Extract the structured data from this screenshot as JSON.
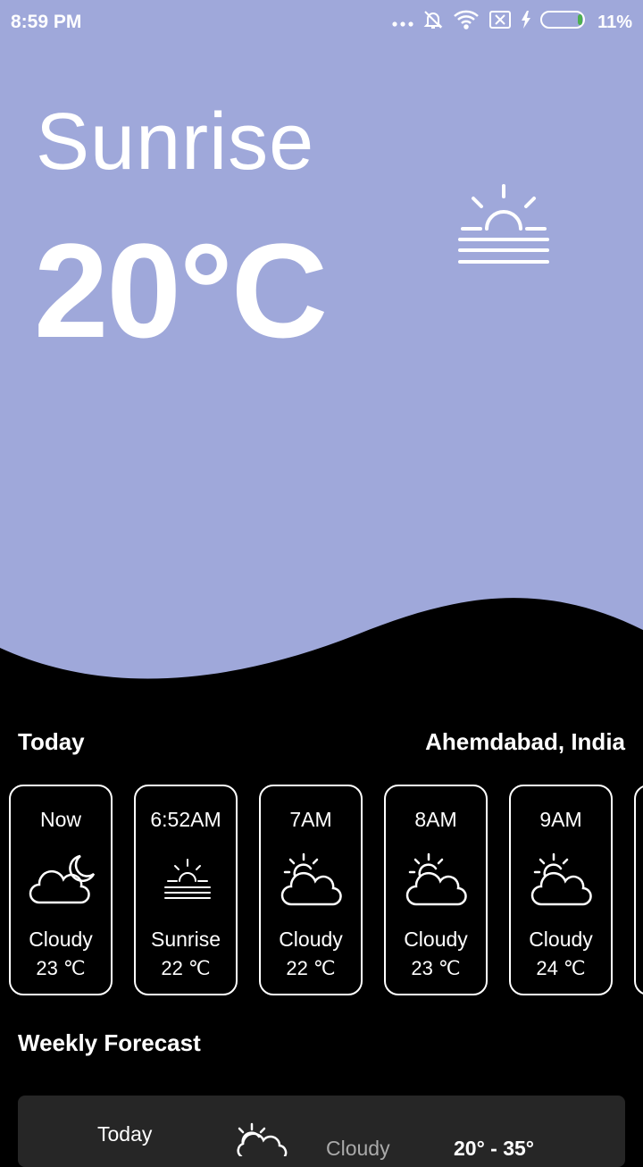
{
  "status_bar": {
    "time": "8:59 PM",
    "battery_percent": "11%",
    "icons": [
      "more-dots-icon",
      "bell-off-icon",
      "wifi-icon",
      "sim-off-icon",
      "charging-icon",
      "battery-icon"
    ]
  },
  "hero": {
    "title": "Sunrise",
    "temperature": "20°C",
    "icon": "sunrise-icon",
    "background_color": "#9fa8da"
  },
  "today": {
    "label": "Today",
    "location": "Ahemdabad, India",
    "hours": [
      {
        "time": "Now",
        "condition": "Cloudy",
        "temp": "23 ℃",
        "icon": "cloud-moon-icon"
      },
      {
        "time": "6:52AM",
        "condition": "Sunrise",
        "temp": "22 ℃",
        "icon": "sunrise-icon"
      },
      {
        "time": "7AM",
        "condition": "Cloudy",
        "temp": "22 ℃",
        "icon": "cloud-sun-icon"
      },
      {
        "time": "8AM",
        "condition": "Cloudy",
        "temp": "23 ℃",
        "icon": "cloud-sun-icon"
      },
      {
        "time": "9AM",
        "condition": "Cloudy",
        "temp": "24 ℃",
        "icon": "cloud-sun-icon"
      }
    ]
  },
  "weekly": {
    "title": "Weekly Forecast",
    "days": [
      {
        "day": "Today",
        "condition": "Cloudy",
        "range": "20° - 35°",
        "icon": "cloud-sun-icon"
      }
    ]
  }
}
